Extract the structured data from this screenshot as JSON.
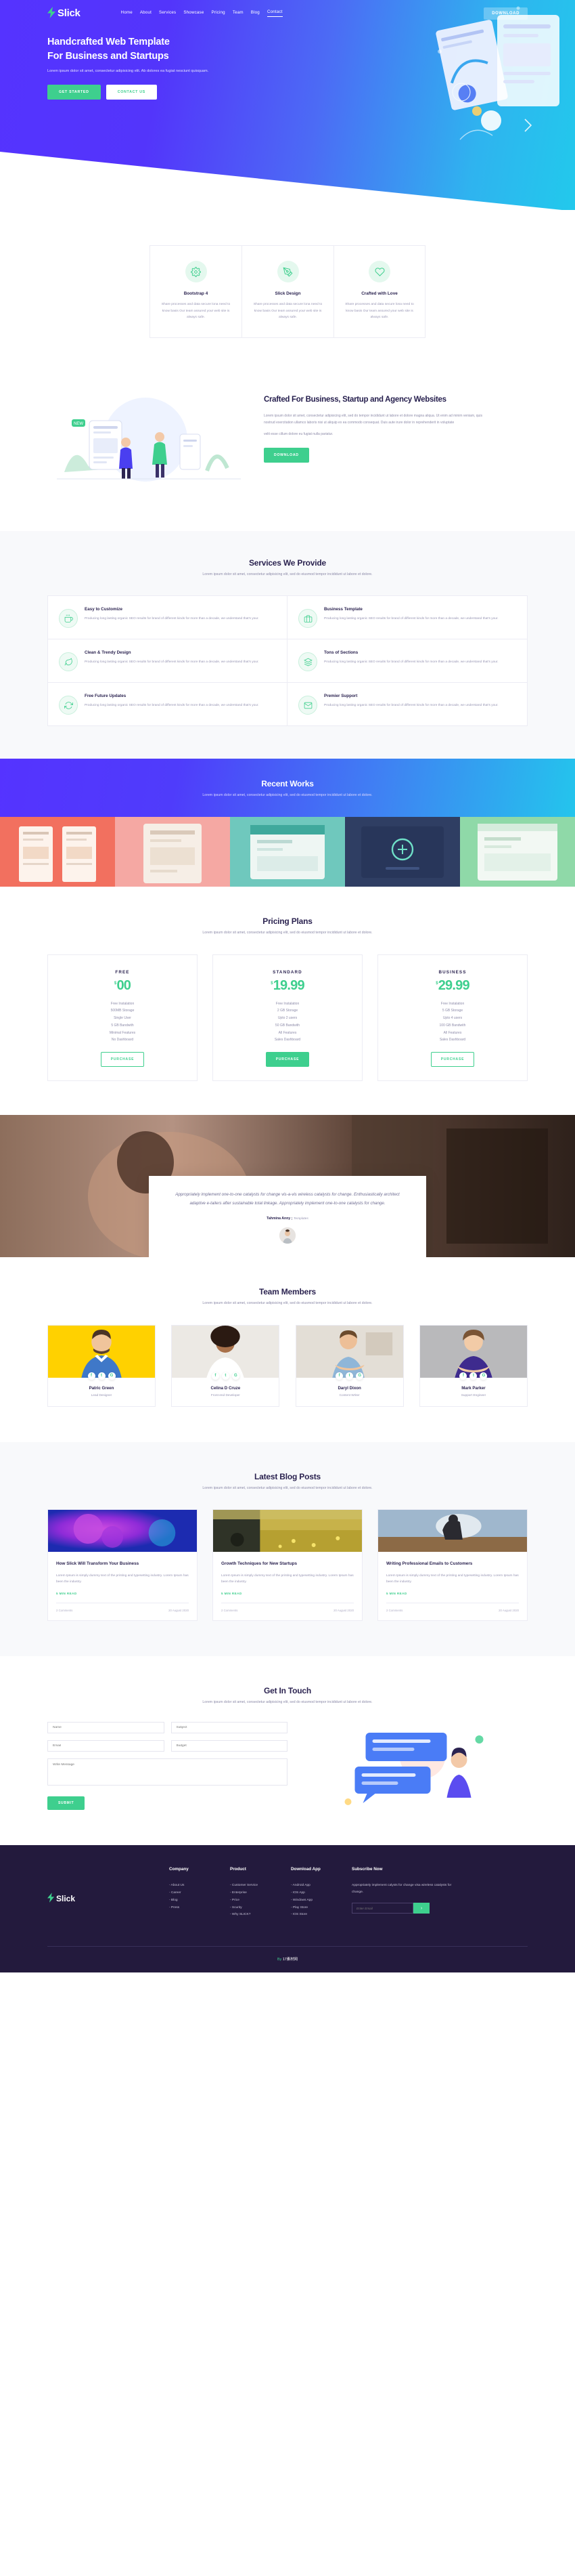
{
  "brand": {
    "name": "Slick",
    "bolt": "⚡"
  },
  "nav": {
    "links": [
      "Home",
      "About",
      "Services",
      "Showcase",
      "Pricing",
      "Team",
      "Blog",
      "Contact"
    ],
    "active": "Contact",
    "download_label": "DOWNLOAD"
  },
  "hero": {
    "title_line1": "Handcrafted Web Template",
    "title_line2": "For Business and Startups",
    "subtitle": "Lorem ipsum dolor sit amet, consectetur adipisicing elit. Ab dolores ea fugiat nesciunt quisquam.",
    "btn_primary": "GET STARTED",
    "btn_secondary": "CONTACT US"
  },
  "features": [
    {
      "icon": "gear-icon",
      "title": "Bootstrap 4",
      "desc": "Share processes and data secure lona need to know basis Our team assured your web site is always safe."
    },
    {
      "icon": "pen-icon",
      "title": "Slick Design",
      "desc": "Share processes and data secure lona need to know basis Our team assured your web site is always safe."
    },
    {
      "icon": "heart-icon",
      "title": "Crafted with Love",
      "desc": "Share processes and data secure lona need to know basis Our team assured your web site is always safe."
    }
  ],
  "crafted": {
    "title": "Crafted For Business, Startup and Agency Websites",
    "p1": "Lorem ipsum dolor sit amet, consectetur adipisicing elit, sed do tempor incididunt ut labore et dolore magna aliqua. Ut enim ad minim veniam, quis nostrud exercitation ullamco laboris nisi ut aliquip ex ea commodo consequat. Duis aute irure dolor in reprehenderit in voluptate",
    "p2": "velit esse cillum dolore eu fugiat nulla pariatur.",
    "button": "DOWNLOAD",
    "badge": "NEW"
  },
  "services": {
    "title": "Services We Provide",
    "subtitle": "Lorem ipsum dolor sit amet, consectetur adipisicing elit, sed do eiusmod tempor incididunt ut labore et dolore.",
    "items": [
      {
        "icon": "coffee-cup-icon",
        "title": "Easy to Customize",
        "desc": "Producing long lasting organic SEO results for brand of different kinds for more than a decade, we understand that's your."
      },
      {
        "icon": "briefcase-icon",
        "title": "Business Template",
        "desc": "Producing long lasting organic SEO results for brand of different kinds for more than a decade, we understand that's your."
      },
      {
        "icon": "leaf-icon",
        "title": "Clean & Trendy Design",
        "desc": "Producing long lasting organic SEO results for brand of different kinds for more than a decade, we understand that's your."
      },
      {
        "icon": "layers-icon",
        "title": "Tons of Sections",
        "desc": "Producing long lasting organic SEO results for brand of different kinds for more than a decade, we understand that's your."
      },
      {
        "icon": "refresh-icon",
        "title": "Free Future Updates",
        "desc": "Producing long lasting organic SEO results for brand of different kinds for more than a decade, we understand that's your."
      },
      {
        "icon": "mail-icon",
        "title": "Premier Support",
        "desc": "Producing long lasting organic SEO results for brand of different kinds for more than a decade, we understand that's your."
      }
    ]
  },
  "works": {
    "title": "Recent Works",
    "subtitle": "Lorem ipsum dolor sit amet, consectetur adipisicing elit, sed do eiusmod tempor incididunt ut labore et dolore.",
    "tiles": [
      "work-thumb-1",
      "work-thumb-2",
      "work-thumb-3",
      "work-thumb-4",
      "work-thumb-5"
    ]
  },
  "pricing": {
    "title": "Pricing Plans",
    "subtitle": "Lorem ipsum dolor sit amet, consectetur adipisicing elit, sed do eiusmod tempor incididunt ut labore et dolore.",
    "currency": "$",
    "plans": [
      {
        "name": "FREE",
        "price": "00",
        "featured": false,
        "features": [
          "Free Instalation",
          "500MB Storage",
          "Single User",
          "5 GB Bandwith",
          "Minimal Features",
          "No Dashboard"
        ],
        "cta": "PURCHASE"
      },
      {
        "name": "STANDARD",
        "price": "19.99",
        "featured": true,
        "features": [
          "Free Instalation",
          "2 GB Storage",
          "Upto 2 users",
          "50 GB Bandwith",
          "All Features",
          "Sales Dashboard"
        ],
        "cta": "PURCHASE"
      },
      {
        "name": "BUSINESS",
        "price": "29.99",
        "featured": false,
        "features": [
          "Free Instalation",
          "5 GB Storage",
          "Upto 4 users",
          "100 GB Bandwith",
          "All Features",
          "Sales Dashboard"
        ],
        "cta": "PURCHASE"
      }
    ]
  },
  "testimonial": {
    "quote": "Appropriately implement one-to-one catalysts for change vis-a-vis wireless catalysts for change. Enthusiastically architect adaptive e-tailers after sustainable total linkage. Appropriately implement one-to-one catalysts for change.",
    "author": "Tahmina Anny ;",
    "role": "Templates"
  },
  "team": {
    "title": "Team Members",
    "subtitle": "Lorem ipsum dolor sit amet, consectetur adipisicing elit, sed do eiusmod tempor incididunt ut labore et dolore.",
    "social": [
      "f",
      "t",
      "G"
    ],
    "members": [
      {
        "name": "Patric Green",
        "role": "Lead Designer",
        "photo": "team-photo-1"
      },
      {
        "name": "Celina D Cruze",
        "role": "Front-end Developer",
        "photo": "team-photo-2"
      },
      {
        "name": "Daryl Dixon",
        "role": "Content Writer",
        "photo": "team-photo-3"
      },
      {
        "name": "Mark Parker",
        "role": "Support Engineer",
        "photo": "team-photo-4"
      }
    ]
  },
  "blog": {
    "title": "Latest Blog Posts",
    "subtitle": "Lorem ipsum dolor sit amet, consectetur adipisicing elit, sed do eiusmod tempor incididunt ut labore et dolore.",
    "posts": [
      {
        "title": "How Slick Will Transform Your Business",
        "desc": "Lorem Ipsum is simply dummy text of the printing and typesetting industry. Lorem Ipsum has been the industry.",
        "read": "5 MIN READ",
        "comments": "2 Comments",
        "date": "20 August 2020",
        "image": "blog-image-1"
      },
      {
        "title": "Growth Techniques for New Startups",
        "desc": "Lorem Ipsum is simply dummy text of the printing and typesetting industry. Lorem Ipsum has been the industry.",
        "read": "5 MIN READ",
        "comments": "2 Comments",
        "date": "20 August 2020",
        "image": "blog-image-2"
      },
      {
        "title": "Writing Professional Emails to Customers",
        "desc": "Lorem Ipsum is simply dummy text of the printing and typesetting industry. Lorem Ipsum has been the industry.",
        "read": "5 MIN READ",
        "comments": "2 Comments",
        "date": "20 August 2020",
        "image": "blog-image-3"
      }
    ]
  },
  "contact": {
    "title": "Get In Touch",
    "subtitle": "Lorem ipsum dolor sit amet, consectetur adipisicing elit, sed do eiusmod tempor incididunt ut labore et dolore.",
    "name_placeholder": "Name",
    "subject_placeholder": "Subject",
    "email_placeholder": "Email",
    "budget_placeholder": "Budget",
    "message_placeholder": "Write Message",
    "submit_label": "SUBMIT"
  },
  "footer": {
    "columns": [
      {
        "head": "Company",
        "items": [
          "- About Us",
          "- Career",
          "- Blog",
          "- Press"
        ]
      },
      {
        "head": "Product",
        "items": [
          "- Customer Service",
          "- Enterprise",
          "- Price",
          "- Scurity",
          "- Why SLICK?"
        ]
      },
      {
        "head": "Download App",
        "items": [
          "- Android App",
          "- IOS App",
          "- Windows App",
          "- Play Store",
          "- IOS Store"
        ]
      }
    ],
    "subscribe": {
      "head": "Subscribe Now",
      "text": "Appropriately implement calysts for change visa wireless catalysts for change.",
      "placeholder": "Enter Email",
      "button_icon": "chevron-right-icon"
    },
    "bottom_by": "By",
    "bottom_name": "17素材网"
  }
}
